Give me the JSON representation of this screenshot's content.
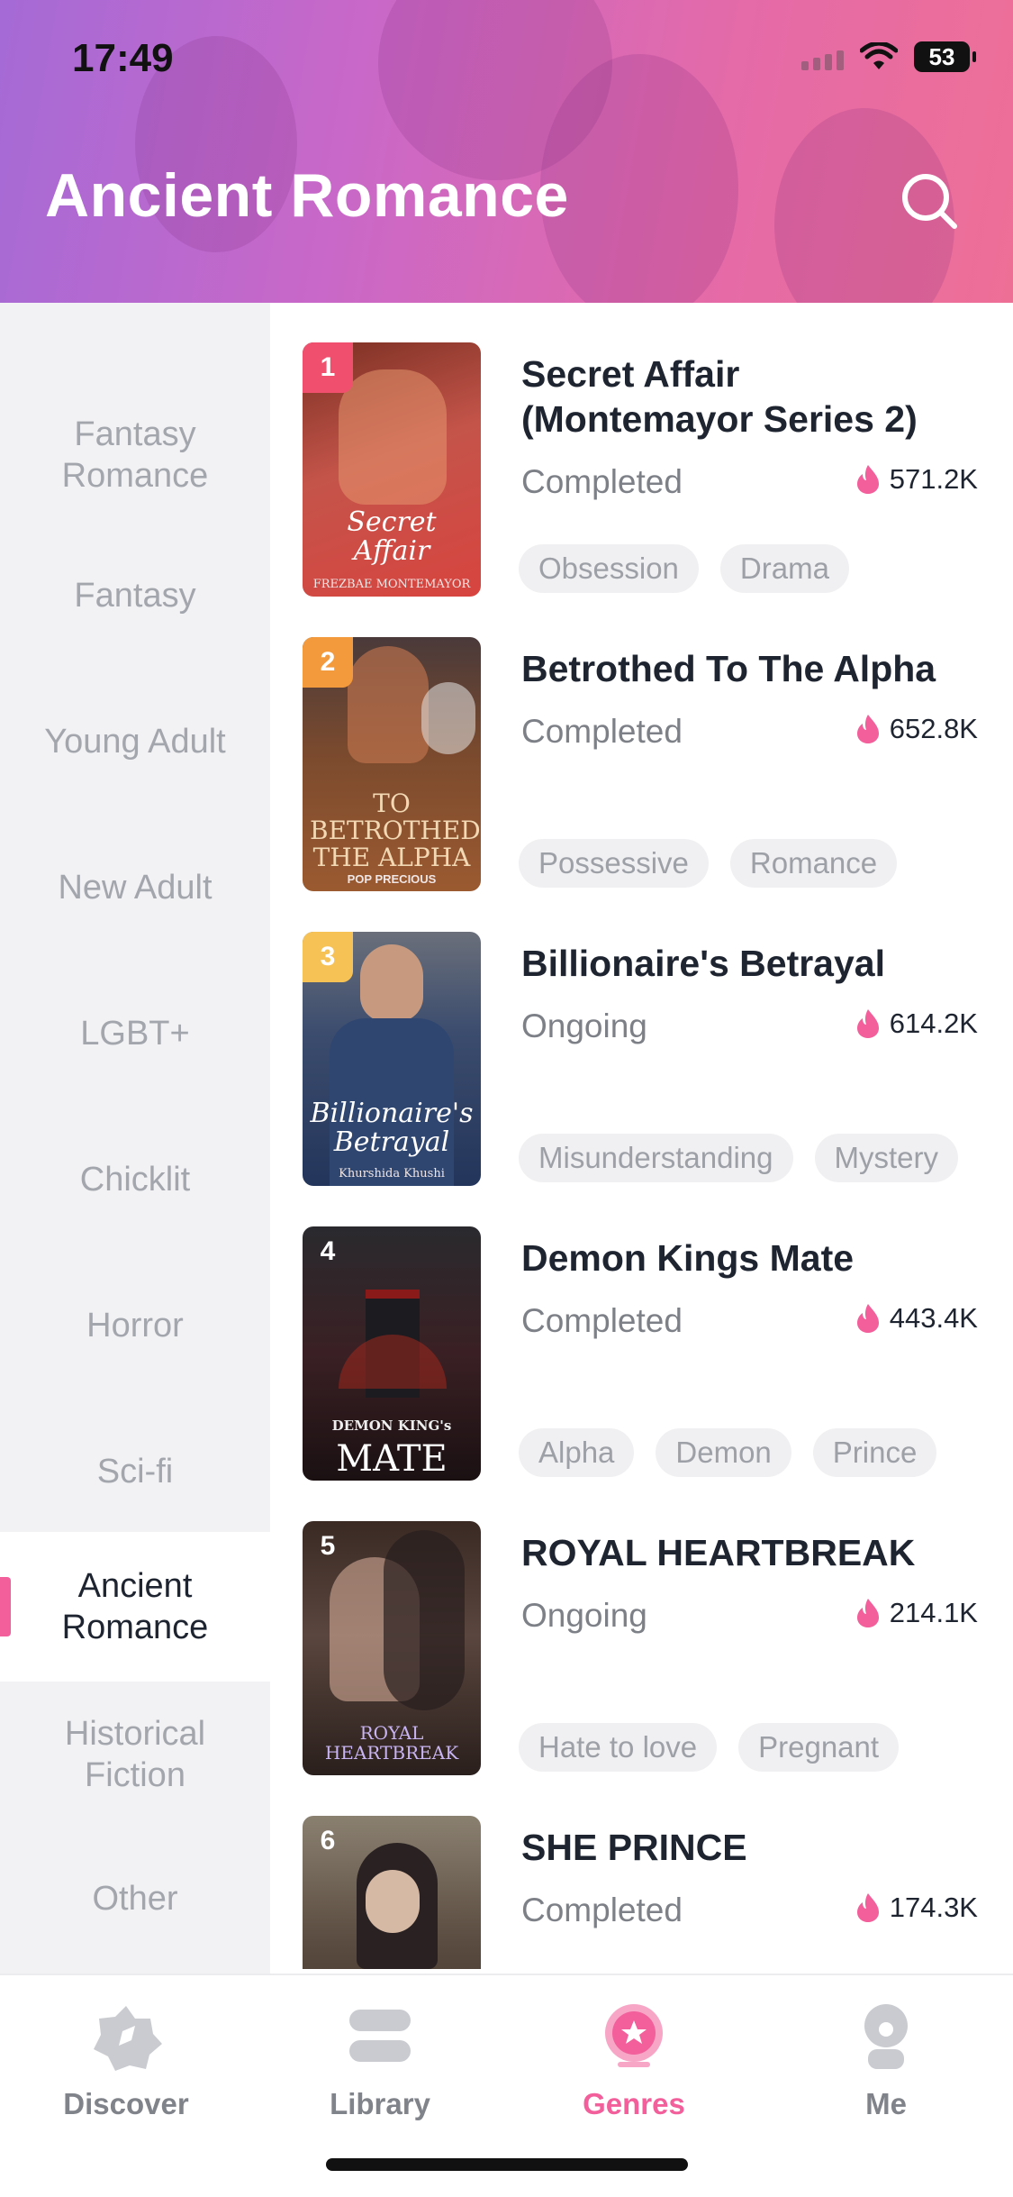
{
  "status_bar": {
    "time": "17:49",
    "battery": "53"
  },
  "header": {
    "title": "Ancient Romance"
  },
  "sidebar": {
    "items": [
      {
        "label": "Fantasy Romance"
      },
      {
        "label": "Fantasy"
      },
      {
        "label": "Young Adult"
      },
      {
        "label": "New Adult"
      },
      {
        "label": "LGBT+"
      },
      {
        "label": "Chicklit"
      },
      {
        "label": "Horror"
      },
      {
        "label": "Sci-fi"
      },
      {
        "label": "Ancient Romance",
        "active": true
      },
      {
        "label": "Historical Fiction"
      },
      {
        "label": "Other"
      }
    ]
  },
  "books": [
    {
      "rank": "1",
      "title": "Secret Affair (Montemayor Series 2)",
      "status": "Completed",
      "reads": "571.2K",
      "tags": [
        "Obsession",
        "Drama"
      ],
      "cover_text": "Secret Affair",
      "cover_author": "FREZBAE MONTEMAYOR"
    },
    {
      "rank": "2",
      "title": "Betrothed To The Alpha",
      "status": "Completed",
      "reads": "652.8K",
      "tags": [
        "Possessive",
        "Romance"
      ],
      "cover_text": "TO BETROTHED THE ALPHA",
      "cover_author": "POP PRECIOUS"
    },
    {
      "rank": "3",
      "title": "Billionaire's Betrayal",
      "status": "Ongoing",
      "reads": "614.2K",
      "tags": [
        "Misunderstanding",
        "Mystery"
      ],
      "cover_text": "Billionaire's Betrayal",
      "cover_author": "Khurshida Khushi"
    },
    {
      "rank": "4",
      "title": "Demon Kings Mate",
      "status": "Completed",
      "reads": "443.4K",
      "tags": [
        "Alpha",
        "Demon",
        "Prince"
      ],
      "cover_text": "MATE",
      "cover_author": "DEMON KING's"
    },
    {
      "rank": "5",
      "title": "ROYAL HEARTBREAK",
      "status": "Ongoing",
      "reads": "214.1K",
      "tags": [
        "Hate to love",
        "Pregnant"
      ],
      "cover_text": "ROYAL HEARTBREAK",
      "cover_author": ""
    },
    {
      "rank": "6",
      "title": "SHE PRINCE",
      "status": "Completed",
      "reads": "174.3K",
      "tags": [],
      "cover_text": "",
      "cover_author": ""
    }
  ],
  "tabbar": {
    "tabs": [
      {
        "label": "Discover"
      },
      {
        "label": "Library"
      },
      {
        "label": "Genres",
        "active": true
      },
      {
        "label": "Me"
      }
    ]
  },
  "colors": {
    "accent": "#f25f9b",
    "rank1": "#f0506e",
    "rank2": "#f39a3c",
    "rank3": "#f6c255"
  }
}
